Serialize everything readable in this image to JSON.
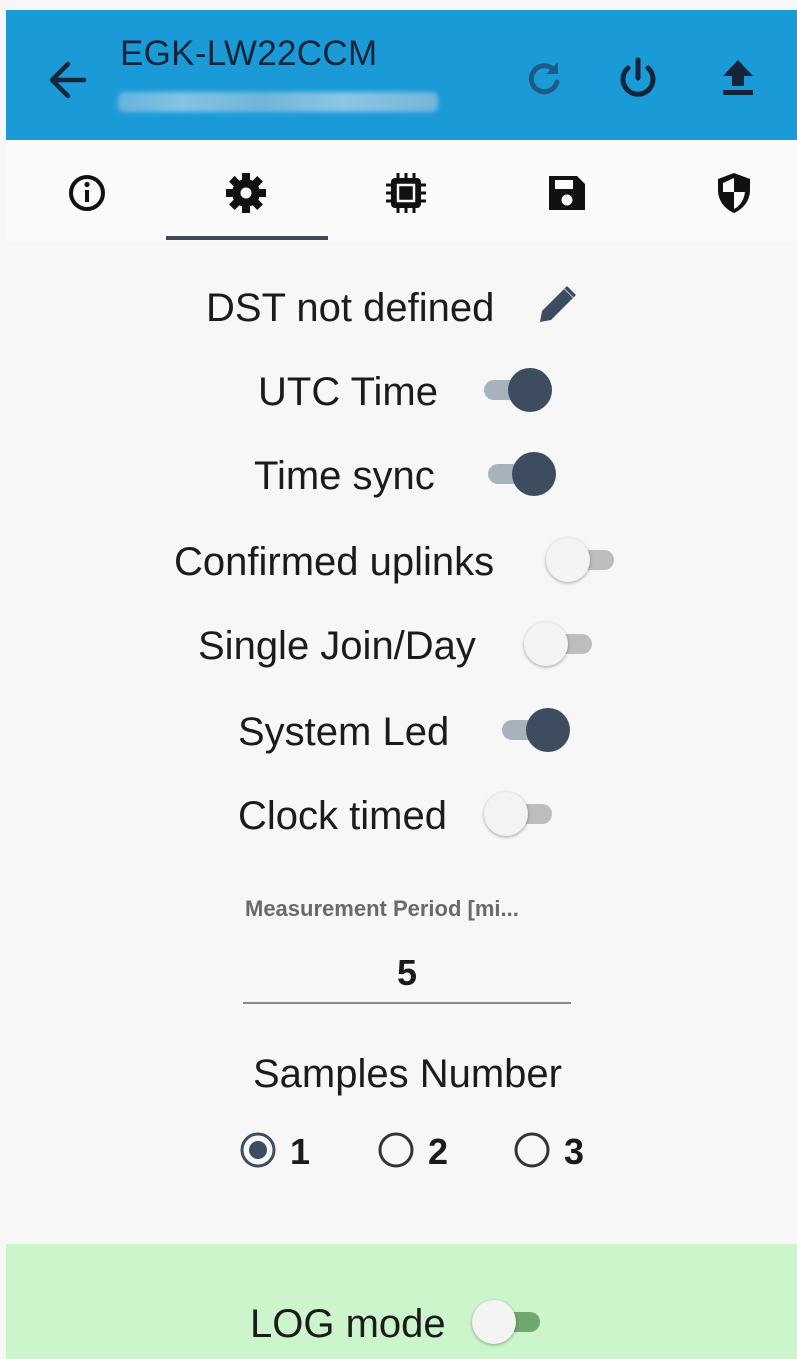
{
  "header": {
    "title": "EGK-LW22CCM",
    "icons": [
      "back-arrow-icon",
      "refresh-icon",
      "power-icon",
      "upload-icon"
    ],
    "background": "#1a9bd8"
  },
  "tabs": {
    "items": [
      "info-icon",
      "gear-icon",
      "chip-icon",
      "floppy-disk-icon",
      "shield-icon"
    ],
    "active_index": 1
  },
  "settings": {
    "dst_label": "DST not defined",
    "utc_time": {
      "label": "UTC Time",
      "on": true
    },
    "time_sync": {
      "label": "Time sync",
      "on": true
    },
    "confirmed_uplinks": {
      "label": "Confirmed uplinks",
      "on": false
    },
    "single_join": {
      "label": "Single Join/Day",
      "on": false
    },
    "system_led": {
      "label": "System Led",
      "on": true
    },
    "clock_timed": {
      "label": "Clock timed",
      "on": false
    }
  },
  "measurement": {
    "label": "Measurement Period [mi...",
    "value": "5"
  },
  "samples": {
    "title": "Samples Number",
    "options": [
      "1",
      "2",
      "3"
    ],
    "selected": "1"
  },
  "footer": {
    "log_mode": {
      "label": "LOG mode",
      "on": false
    },
    "background": "#ccf5cc"
  },
  "colors": {
    "switch_on_thumb": "#3e4c5f",
    "switch_on_track": "#a8b2bd",
    "switch_off_thumb": "#f3f3f3"
  }
}
